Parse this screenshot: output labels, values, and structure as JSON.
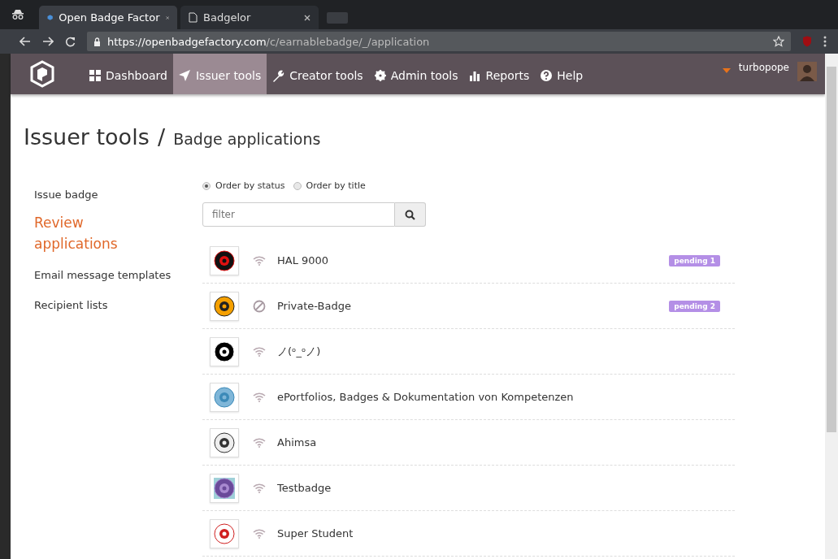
{
  "browser": {
    "tabs": [
      {
        "label": "Open Badge Factor",
        "selected": true
      },
      {
        "label": "Badgelor",
        "selected": false
      }
    ],
    "url_host": "https://openbadgefactory.com",
    "url_path": "/c/earnablebadge/_/application"
  },
  "nav": {
    "items": [
      {
        "label": "Dashboard",
        "kind": "grid",
        "selected": false
      },
      {
        "label": "Issuer tools",
        "kind": "plane",
        "selected": true
      },
      {
        "label": "Creator tools",
        "kind": "wrench",
        "selected": false
      },
      {
        "label": "Admin tools",
        "kind": "gear",
        "selected": false
      },
      {
        "label": "Reports",
        "kind": "bars",
        "selected": false
      },
      {
        "label": "Help",
        "kind": "help",
        "selected": false
      }
    ],
    "user": "turbopope"
  },
  "heading": {
    "title": "Issuer tools",
    "separator": "/",
    "subtitle": "Badge applications"
  },
  "sidebar": {
    "items": [
      {
        "label": "Issue badge",
        "selected": false
      },
      {
        "label": "Review applications",
        "selected": true
      },
      {
        "label": "Email message templates",
        "selected": false
      },
      {
        "label": "Recipient lists",
        "selected": false
      }
    ]
  },
  "order": [
    {
      "label": "Order by status",
      "selected": true
    },
    {
      "label": "Order by title",
      "selected": false
    }
  ],
  "filter": {
    "placeholder": "filter"
  },
  "badges": [
    {
      "name": "HAL 9000",
      "kind": "public",
      "pending": "pending 1"
    },
    {
      "name": "Private-Badge",
      "kind": "private",
      "pending": "pending 2"
    },
    {
      "name": "ノ(ᵒ_ᵒノ)",
      "kind": "public"
    },
    {
      "name": "ePortfolios, Badges & Dokumentation von Kompetenzen",
      "kind": "public"
    },
    {
      "name": "Ahimsa",
      "kind": "public"
    },
    {
      "name": "Testbadge",
      "kind": "public"
    },
    {
      "name": "Super Student",
      "kind": "public"
    }
  ]
}
